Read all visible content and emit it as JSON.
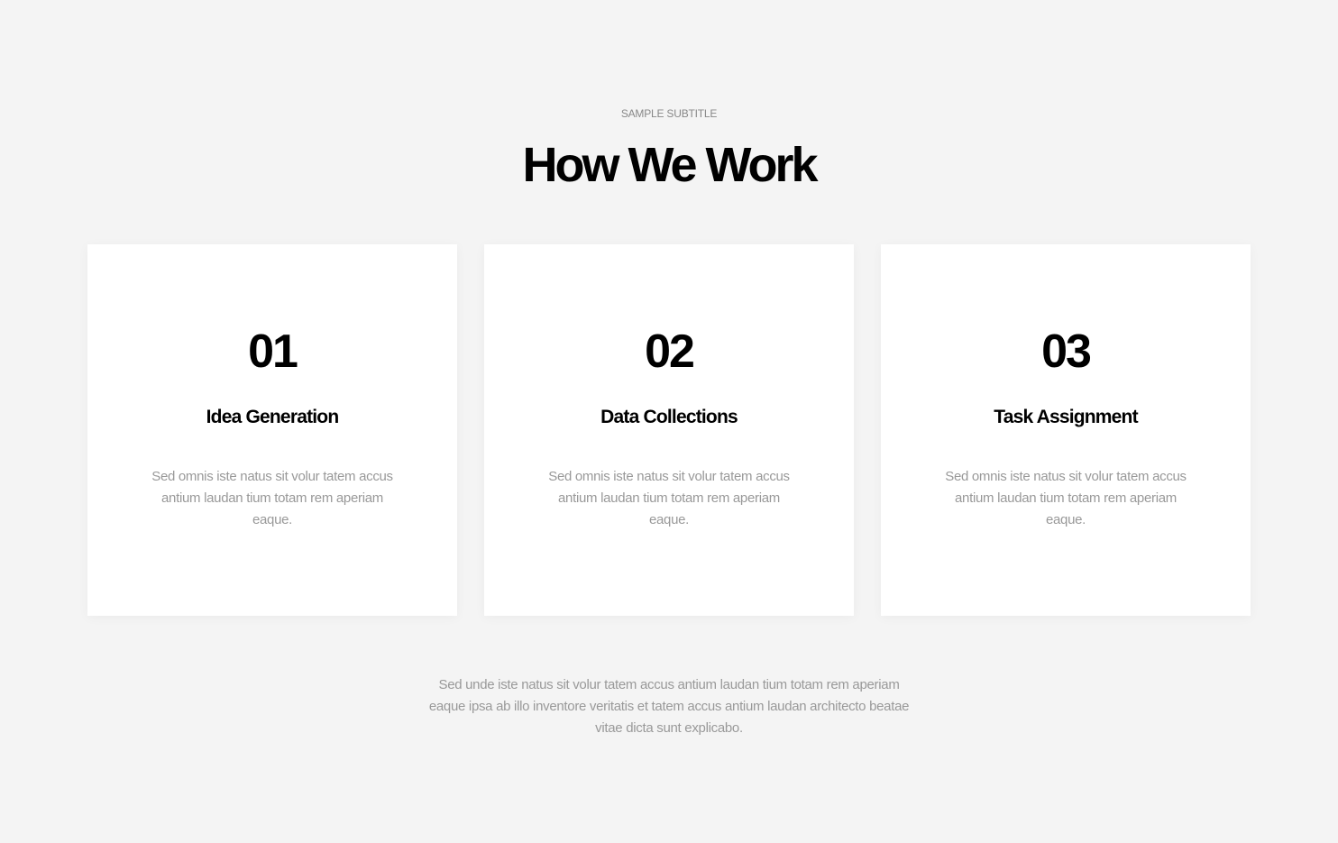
{
  "header": {
    "subtitle": "SAMPLE SUBTITLE",
    "title": "How We Work"
  },
  "cards": [
    {
      "number": "01",
      "title": "Idea Generation",
      "description": "Sed omnis iste natus sit volur tatem accus antium laudan tium totam rem aperiam eaque."
    },
    {
      "number": "02",
      "title": "Data Collections",
      "description": "Sed omnis iste natus sit volur tatem accus antium laudan tium totam rem aperiam eaque."
    },
    {
      "number": "03",
      "title": "Task Assignment",
      "description": "Sed omnis iste natus sit volur tatem accus antium laudan tium totam rem aperiam eaque."
    }
  ],
  "footer": {
    "text": "Sed unde iste natus sit volur tatem accus antium laudan tium totam rem aperiam eaque ipsa ab illo inventore veritatis et tatem accus antium laudan architecto beatae vitae dicta sunt explicabo."
  }
}
